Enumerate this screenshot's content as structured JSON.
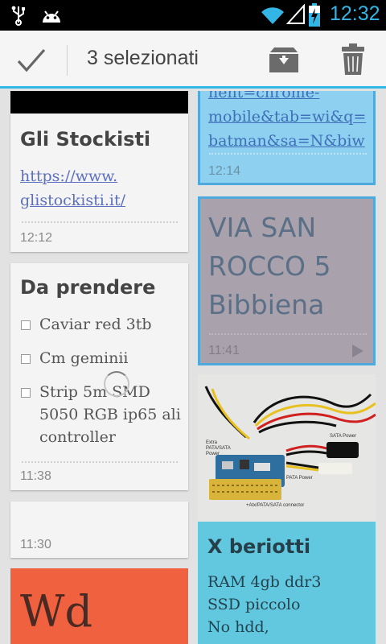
{
  "status_bar": {
    "time": "12:32",
    "icons": [
      "usb-icon",
      "android-icon",
      "wifi-icon",
      "signal-icon",
      "battery-charging-icon"
    ]
  },
  "action_bar": {
    "title": "3 selezionati",
    "accent": "#33b5e5"
  },
  "notes": {
    "stockisti": {
      "title": "Gli Stockisti",
      "link_line1": "https://www.",
      "link_line2": "glistockisti.it/",
      "time": "12:12"
    },
    "prendere": {
      "title": "Da prendere",
      "items": [
        "Caviar red 3tb",
        "Cm geminii",
        "Strip 5m SMD",
        "5050 RGB ip65 ali",
        "controller"
      ],
      "time": "11:38"
    },
    "blank": {
      "time": "11:30"
    },
    "wd": {
      "title": "Wd",
      "color": "#f0613f"
    },
    "url_note": {
      "line1": "nent=chrome-",
      "line2": "mobile&tab=wi&q=",
      "line3": "batman&sa=N&biw",
      "time": "12:14",
      "color": "#8ed0ef"
    },
    "via": {
      "line1": "VIA SAN",
      "line2": "ROCCO 5",
      "line3": "Bibbiena",
      "time": "11:41",
      "color": "#a9a2ad"
    },
    "beriotti": {
      "photo_labels": {
        "a": "Extra",
        "b": "PATA/SATA",
        "c": "Power",
        "d": "SATA Power",
        "e": "PATA Power",
        "f": "+Atx/PATA/SATA connector"
      },
      "title": "X beriotti",
      "line1": "RAM 4gb ddr3",
      "line2": "SSD piccolo",
      "line3": "No hdd,",
      "color": "#62c8e0"
    }
  }
}
